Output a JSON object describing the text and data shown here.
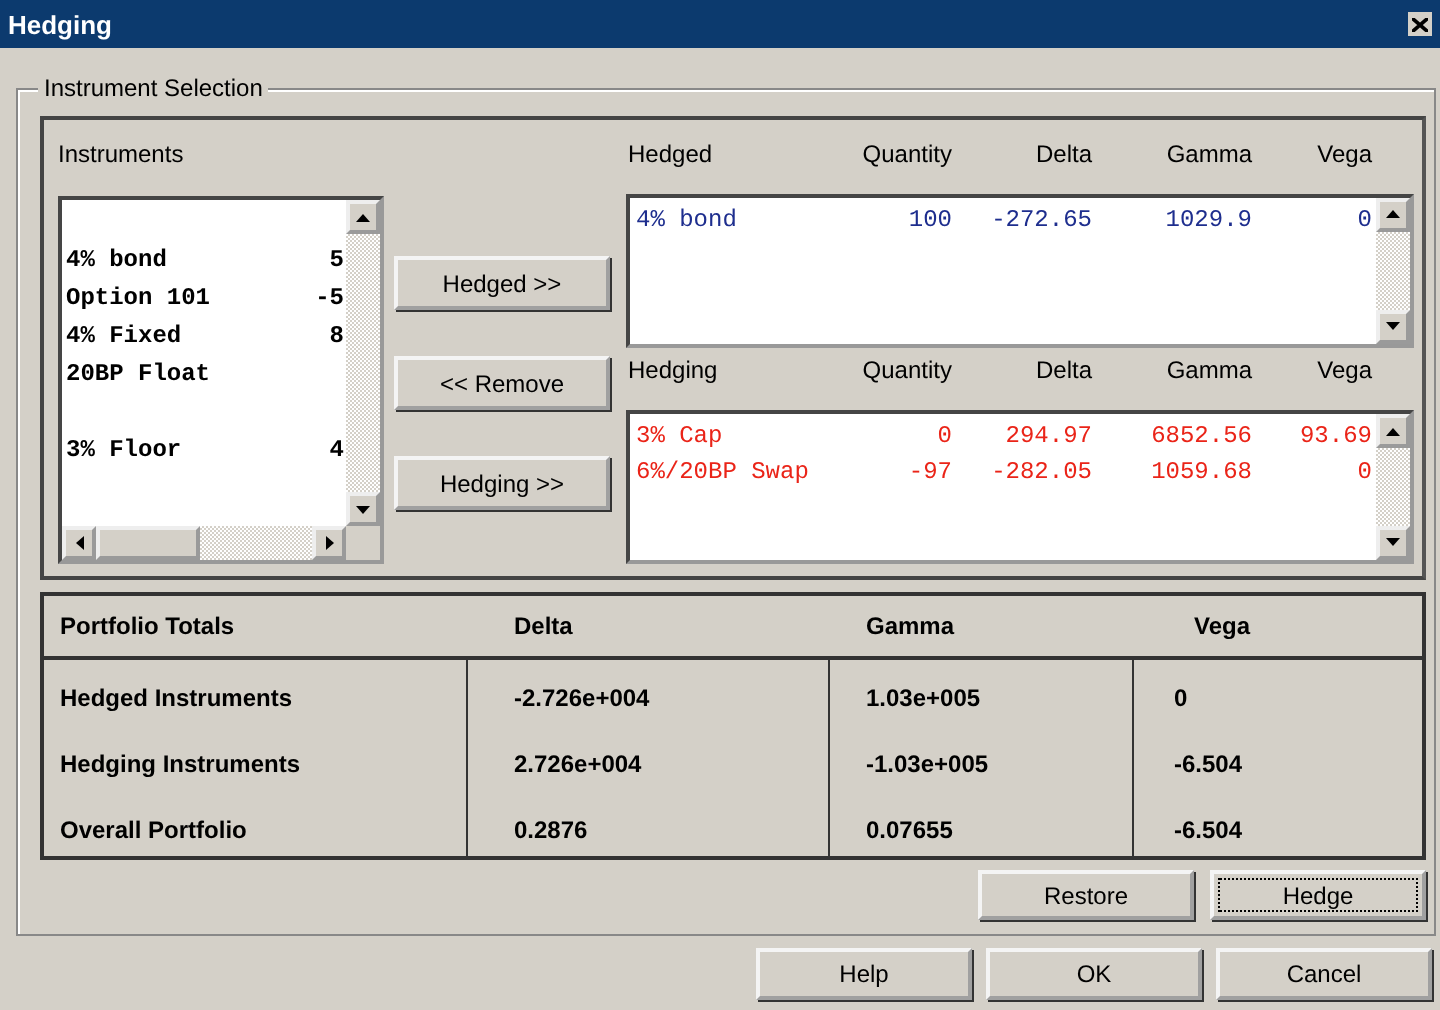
{
  "window": {
    "title": "Hedging"
  },
  "instrument_selection": {
    "title": "Instrument Selection",
    "instruments": {
      "label": "Instruments",
      "items": [
        {
          "kind": "blank"
        },
        {
          "kind": "instrument",
          "name": "4% bond",
          "quantity": "5"
        },
        {
          "kind": "instrument",
          "name": "Option 101",
          "quantity": "-5"
        },
        {
          "kind": "instrument",
          "name": "4% Fixed",
          "quantity": "8"
        },
        {
          "kind": "instrument",
          "name": "20BP Float"
        },
        {
          "kind": "blank"
        },
        {
          "kind": "instrument",
          "name": "3% Floor",
          "quantity": "4"
        }
      ]
    },
    "buttons": [
      "Hedged >>",
      "<< Remove",
      "Hedging >>"
    ],
    "hedged": {
      "columns": [
        "Hedged",
        "Quantity",
        "Delta",
        "Gamma",
        "Vega"
      ],
      "rows": [
        [
          "4% bond",
          "100",
          "-272.65",
          "1029.9",
          "0"
        ]
      ]
    },
    "hedging": {
      "columns": [
        "Hedging",
        "Quantity",
        "Delta",
        "Gamma",
        "Vega"
      ],
      "rows": [
        [
          "3% Cap",
          "0",
          "294.97",
          "6852.56",
          "93.69"
        ],
        [
          "6%/20BP Swap",
          "-97",
          "-282.05",
          "1059.68",
          "0"
        ]
      ]
    }
  },
  "portfolio_totals": {
    "columns": [
      "Portfolio Totals",
      "Delta",
      "Gamma",
      "Vega"
    ],
    "rows": [
      [
        "Hedged Instruments",
        "-2.726e+004",
        "1.03e+005",
        "0"
      ],
      [
        "Hedging Instruments",
        "2.726e+004",
        "-1.03e+005",
        "-6.504"
      ],
      [
        "Overall Portfolio",
        "0.2876",
        "0.07655",
        "-6.504"
      ]
    ]
  },
  "action_buttons": [
    {
      "label": "Restore",
      "focused": false
    },
    {
      "label": "Hedge",
      "focused": true
    }
  ],
  "dialog_buttons": [
    "Help",
    "OK",
    "Cancel"
  ]
}
